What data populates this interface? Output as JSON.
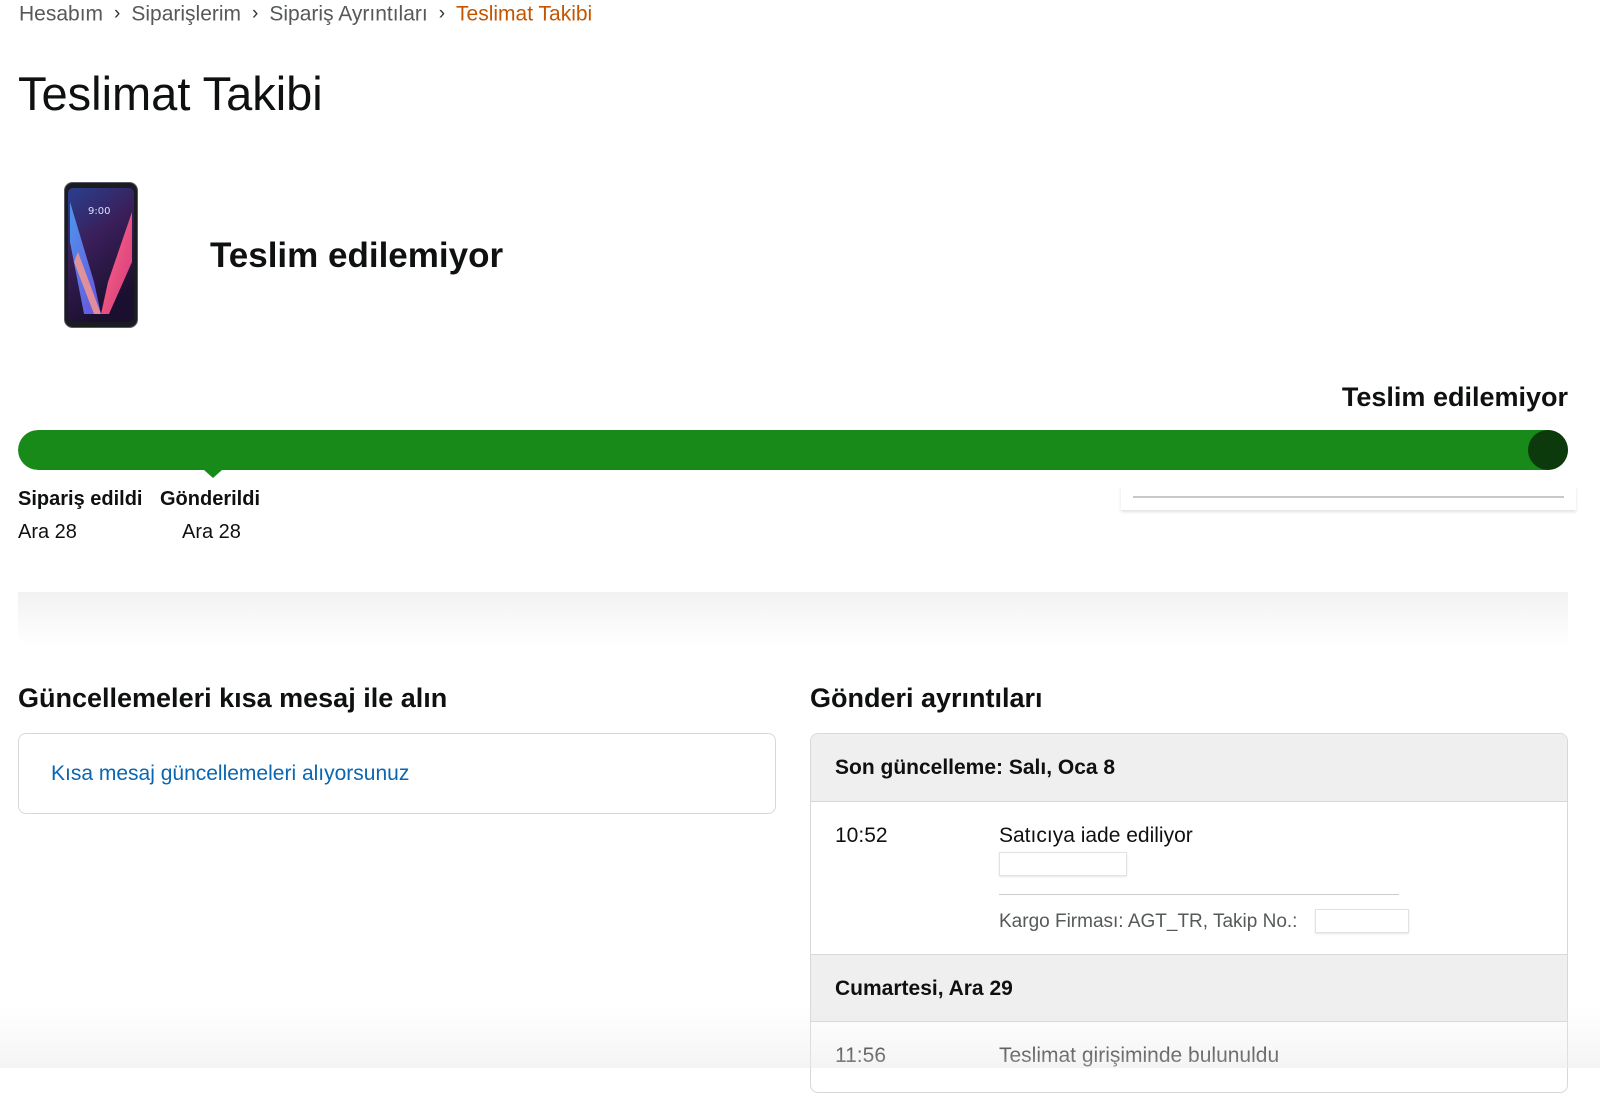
{
  "breadcrumb": {
    "items": [
      {
        "label": "Hesabım"
      },
      {
        "label": "Siparişlerim"
      },
      {
        "label": "Sipariş Ayrıntıları"
      },
      {
        "label": "Teslimat Takibi"
      }
    ],
    "separator": "›"
  },
  "page": {
    "title": "Teslimat Takibi",
    "status": "Teslim edilemiyor"
  },
  "product": {
    "image_icon": "phone-product-image",
    "screen_time": "9:00"
  },
  "progress": {
    "label": "Teslim edilemiyor",
    "fraction": 1.0,
    "fill_color": "#178a19",
    "knob_color": "#0c3a0c",
    "milestones": [
      {
        "label": "Sipariş edildi",
        "date": "Ara 28"
      },
      {
        "label": "Gönderildi",
        "date": "Ara 28"
      }
    ]
  },
  "sms": {
    "title": "Güncellemeleri kısa mesaj ile alın",
    "link": "Kısa mesaj güncellemeleri alıyorsunuz",
    "link_color": "#0a66b0"
  },
  "shipment": {
    "title": "Gönderi ayrıntıları",
    "days": [
      {
        "header": "Son güncelleme: Salı, Oca 8",
        "events": [
          {
            "time": "10:52",
            "text": "Satıcıya iade ediliyor",
            "carrier": "Kargo Firması: AGT_TR, Takip No.:"
          }
        ]
      },
      {
        "header": "Cumartesi, Ara 29",
        "events": [
          {
            "time": "11:56",
            "text": "Teslimat girişiminde bulunuldu"
          }
        ]
      }
    ]
  },
  "colors": {
    "accent_orange": "#c45500",
    "text": "#0f1111",
    "muted": "#565959"
  }
}
